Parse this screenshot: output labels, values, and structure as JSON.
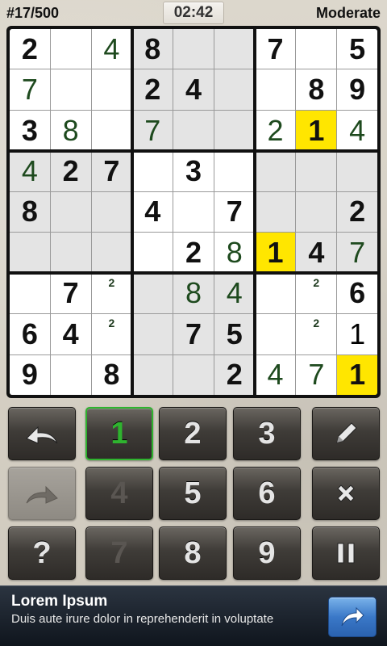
{
  "header": {
    "puzzle_number": "#17/500",
    "timer": "02:42",
    "difficulty": "Moderate"
  },
  "board": {
    "rows": [
      [
        "2",
        "",
        "4",
        "8",
        "",
        "",
        "7",
        "",
        "5"
      ],
      [
        "7",
        "",
        "",
        "2",
        "4",
        "",
        "",
        "8",
        "9"
      ],
      [
        "3",
        "8",
        "",
        "7",
        "",
        "",
        "2",
        "1",
        "4"
      ],
      [
        "4",
        "2",
        "7",
        "",
        "3",
        "",
        "",
        "",
        ""
      ],
      [
        "8",
        "",
        "",
        "4",
        "",
        "7",
        "",
        "",
        "2"
      ],
      [
        "",
        "",
        "",
        "",
        "2",
        "8",
        "1",
        "4",
        "7"
      ],
      [
        "",
        "7",
        "",
        "",
        "8",
        "4",
        "",
        "",
        "6"
      ],
      [
        "6",
        "4",
        "",
        "",
        "7",
        "5",
        "",
        "",
        "1"
      ],
      [
        "9",
        "",
        "8",
        "",
        "",
        "2",
        "4",
        "7",
        "1"
      ]
    ],
    "cell_types": [
      [
        "g",
        "",
        "u",
        "g",
        "",
        "",
        "g",
        "",
        "g"
      ],
      [
        "u",
        "",
        "",
        "g",
        "g",
        "",
        "",
        "g",
        "g"
      ],
      [
        "g",
        "u",
        "",
        "u",
        "",
        "",
        "u",
        "h",
        "u"
      ],
      [
        "u",
        "g",
        "g",
        "",
        "g",
        "",
        "",
        "",
        ""
      ],
      [
        "g",
        "",
        "",
        "g",
        "",
        "g",
        "",
        "",
        "g"
      ],
      [
        "",
        "",
        "",
        "",
        "g",
        "u",
        "h",
        "g",
        "u"
      ],
      [
        "",
        "g",
        "",
        "",
        "u",
        "u",
        "",
        "",
        "g"
      ],
      [
        "g",
        "g",
        "",
        "",
        "g",
        "g",
        "",
        "",
        ""
      ],
      [
        "g",
        "",
        "g",
        "",
        "",
        "g",
        "u",
        "u",
        "h"
      ]
    ],
    "notes": [
      {
        "row": 6,
        "col": 2,
        "value": "2"
      },
      {
        "row": 6,
        "col": 7,
        "value": "2"
      },
      {
        "row": 7,
        "col": 2,
        "value": "2"
      },
      {
        "row": 7,
        "col": 7,
        "value": "2"
      }
    ],
    "shade_pattern": [
      [
        "w",
        "w",
        "w",
        "g",
        "g",
        "g",
        "w",
        "w",
        "w"
      ],
      [
        "w",
        "w",
        "w",
        "g",
        "g",
        "g",
        "w",
        "w",
        "w"
      ],
      [
        "w",
        "w",
        "w",
        "g",
        "g",
        "g",
        "w",
        "w",
        "w"
      ],
      [
        "g",
        "g",
        "g",
        "w",
        "w",
        "w",
        "g",
        "g",
        "g"
      ],
      [
        "g",
        "g",
        "g",
        "w",
        "w",
        "w",
        "g",
        "g",
        "g"
      ],
      [
        "g",
        "g",
        "g",
        "w",
        "w",
        "w",
        "g",
        "g",
        "g"
      ],
      [
        "w",
        "w",
        "w",
        "g",
        "g",
        "g",
        "w",
        "w",
        "w"
      ],
      [
        "w",
        "w",
        "w",
        "g",
        "g",
        "g",
        "w",
        "w",
        "w"
      ],
      [
        "w",
        "w",
        "w",
        "g",
        "g",
        "g",
        "w",
        "w",
        "w"
      ]
    ],
    "highlight_color": "#ffe600",
    "given_color": "#111111",
    "user_color": "#1e4a1e"
  },
  "keypad": {
    "undo": {
      "icon": "undo-arrow-icon"
    },
    "redo": {
      "icon": "redo-arrow-icon"
    },
    "pencil": {
      "icon": "pencil-icon"
    },
    "erase": {
      "icon": "x-erase-icon"
    },
    "hint": {
      "label": "?"
    },
    "pause": {
      "icon": "pause-icon"
    },
    "digits": [
      {
        "label": "1",
        "state": "selected"
      },
      {
        "label": "2",
        "state": "normal"
      },
      {
        "label": "3",
        "state": "normal"
      },
      {
        "label": "4",
        "state": "disabled"
      },
      {
        "label": "5",
        "state": "normal"
      },
      {
        "label": "6",
        "state": "normal"
      },
      {
        "label": "7",
        "state": "disabled"
      },
      {
        "label": "8",
        "state": "normal"
      },
      {
        "label": "9",
        "state": "normal"
      }
    ],
    "selected_color": "#2fb32f"
  },
  "ad": {
    "title": "Lorem Ipsum",
    "text": "Duis aute irure dolor in reprehenderit in voluptate",
    "button_icon": "share-arrow-icon"
  }
}
